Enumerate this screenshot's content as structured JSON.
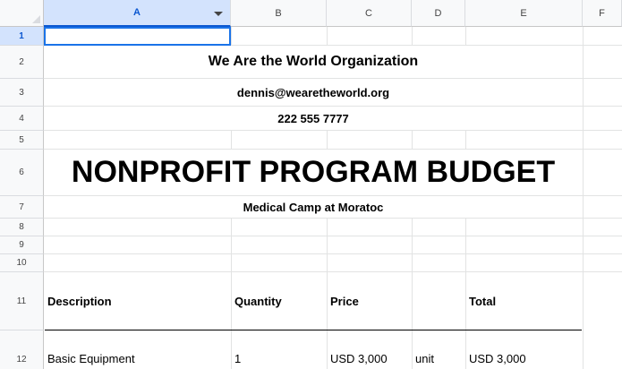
{
  "columns": [
    "A",
    "B",
    "C",
    "D",
    "E",
    "F"
  ],
  "rows": [
    "1",
    "2",
    "3",
    "4",
    "5",
    "6",
    "7",
    "8",
    "9",
    "10",
    "11",
    "12"
  ],
  "org": {
    "name": "We Are the World Organization",
    "email": "dennis@wearetheworld.org",
    "phone": "222 555 7777"
  },
  "title": "NONPROFIT PROGRAM BUDGET",
  "subtitle": "Medical Camp at Moratoc",
  "table": {
    "headers": [
      "Description",
      "Quantity",
      "Price",
      "Total"
    ],
    "rows": [
      {
        "description": "Basic Equipment",
        "quantity": "1",
        "price": "USD 3,000",
        "unit": "unit",
        "total": "USD 3,000"
      }
    ]
  },
  "colors": {
    "selection": "#1a73e8",
    "header_bg": "#f8f9fa",
    "header_selected_bg": "#d3e3fd"
  }
}
